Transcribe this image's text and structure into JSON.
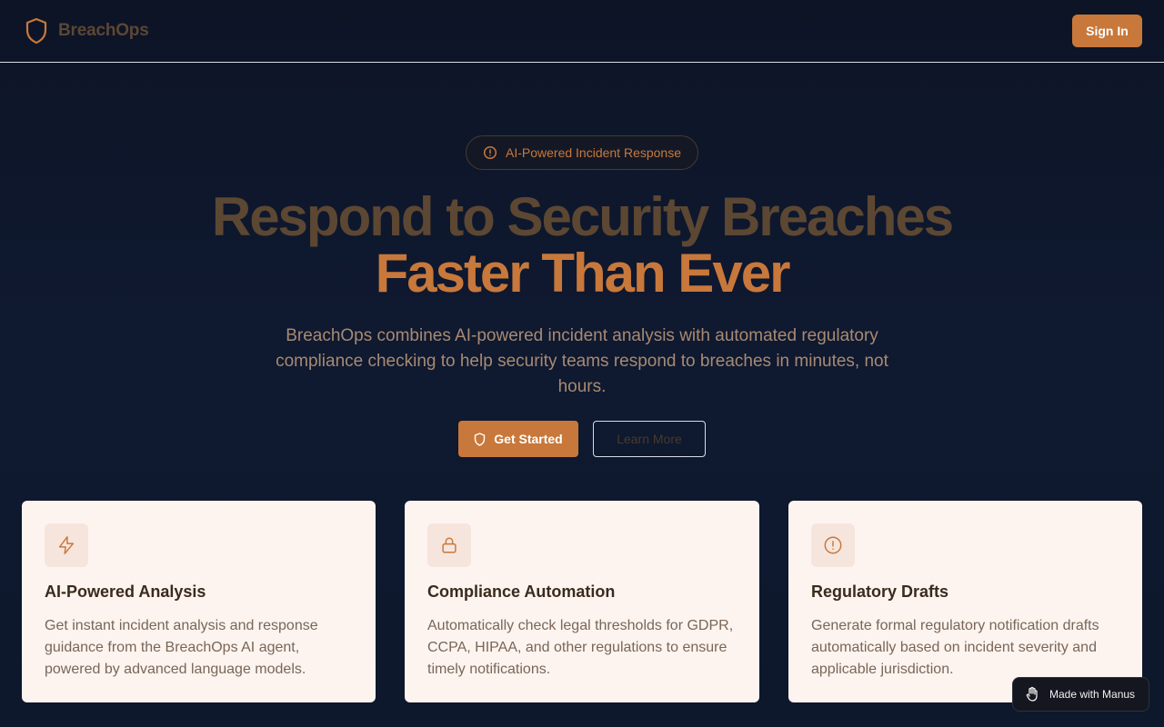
{
  "header": {
    "brand_name": "BreachOps",
    "signin_label": "Sign In"
  },
  "hero": {
    "badge_text": "AI-Powered Incident Response",
    "headline_line1": "Respond to Security Breaches",
    "headline_line2": "Faster Than Ever",
    "subtext": "BreachOps combines AI-powered incident analysis with automated regulatory compliance checking to help security teams respond to breaches in minutes, not hours.",
    "primary_cta": "Get Started",
    "secondary_cta": "Learn More"
  },
  "features": [
    {
      "icon": "lightning-icon",
      "title": "AI-Powered Analysis",
      "description": "Get instant incident analysis and response guidance from the BreachOps AI agent, powered by advanced language models."
    },
    {
      "icon": "lock-icon",
      "title": "Compliance Automation",
      "description": "Automatically check legal thresholds for GDPR, CCPA, HIPAA, and other regulations to ensure timely notifications."
    },
    {
      "icon": "alert-circle-icon",
      "title": "Regulatory Drafts",
      "description": "Generate formal regulatory notification drafts automatically based on incident severity and applicable jurisdiction."
    }
  ],
  "manus_badge": "Made with Manus",
  "colors": {
    "accent": "#c8783b",
    "background": "#0f1930",
    "card_bg": "#fdf4f0"
  }
}
